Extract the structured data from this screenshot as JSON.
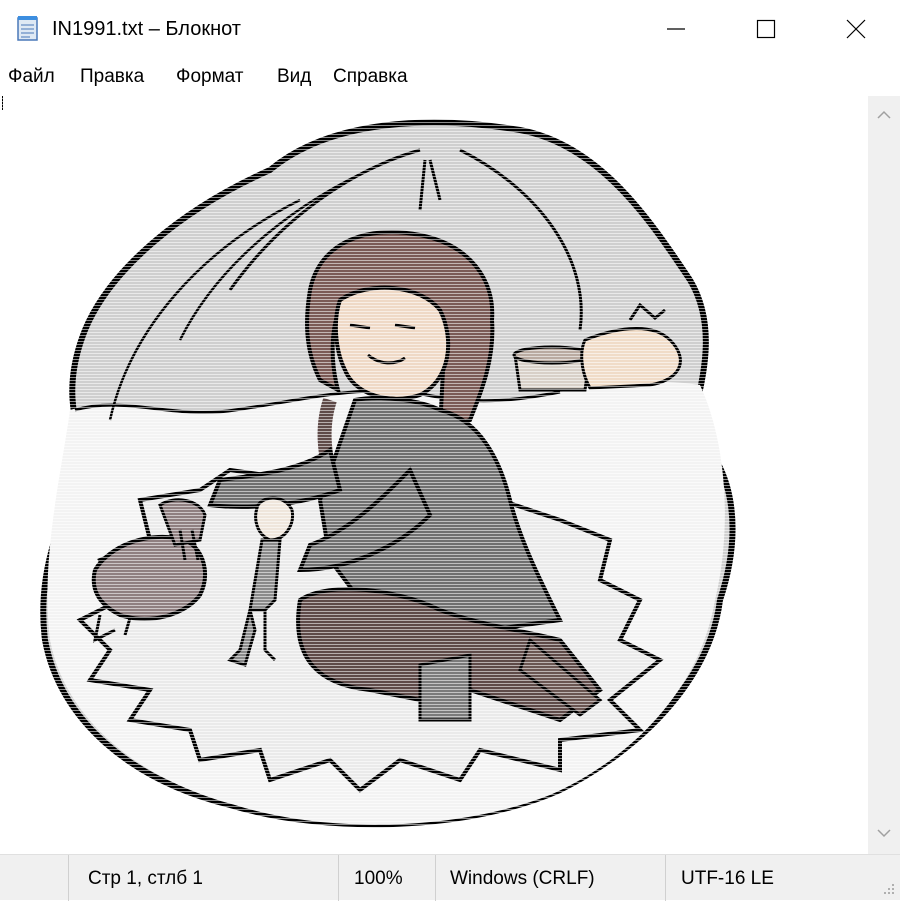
{
  "window": {
    "title": "IN1991.txt – Блокнот",
    "icon": "notepad-icon",
    "controls": [
      "minimize-icon",
      "maximize-icon",
      "close-icon"
    ]
  },
  "menu": {
    "items": [
      "Файл",
      "Правка",
      "Формат",
      "Вид",
      "Справка"
    ]
  },
  "editor": {
    "content": "ascii-art-image",
    "scrollbar_icons": [
      "chevron-up-icon",
      "chevron-down-icon"
    ]
  },
  "status": {
    "position": "Стр 1, стлб 1",
    "zoom": "100%",
    "line_endings": "Windows (CRLF)",
    "encoding": "UTF-16 LE"
  },
  "colors": {
    "background": "#ffffff",
    "chrome": "#f0f0f0",
    "art_gray": "#c9c9c9",
    "art_brown": "#7b5a55",
    "art_dark": "#5e4a48",
    "skin": "#efd9c6"
  }
}
